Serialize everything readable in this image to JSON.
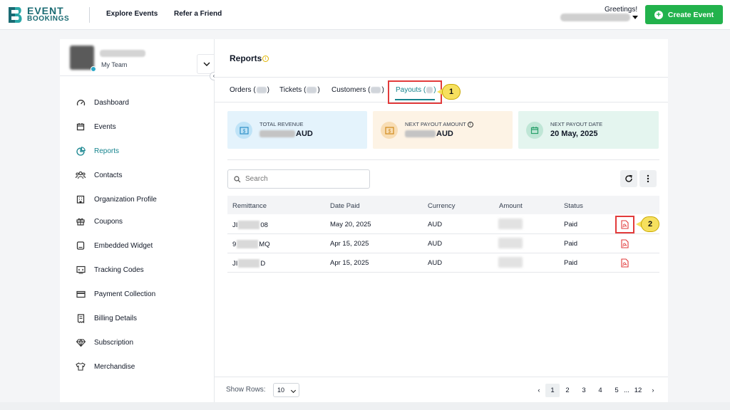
{
  "header": {
    "logo_line1": "EVENT",
    "logo_line2": "BOOKINGS",
    "nav": [
      "Explore Events",
      "Refer a Friend"
    ],
    "greeting": "Greetings!",
    "create_label": "Create Event"
  },
  "sidebar": {
    "team_label": "My Team",
    "items": [
      {
        "label": "Dashboard",
        "icon": "gauge-icon"
      },
      {
        "label": "Events",
        "icon": "calendar-icon"
      },
      {
        "label": "Reports",
        "icon": "pie-chart-icon",
        "active": true
      },
      {
        "label": "Contacts",
        "icon": "users-icon"
      },
      {
        "label": "Organization Profile",
        "icon": "building-icon"
      },
      {
        "label": "Coupons",
        "icon": "gift-icon"
      },
      {
        "label": "Embedded Widget",
        "icon": "widget-icon"
      },
      {
        "label": "Tracking Codes",
        "icon": "code-icon"
      },
      {
        "label": "Payment Collection",
        "icon": "card-icon"
      },
      {
        "label": "Billing Details",
        "icon": "receipt-icon"
      },
      {
        "label": "Subscription",
        "icon": "diamond-icon"
      },
      {
        "label": "Merchandise",
        "icon": "shirt-icon"
      }
    ]
  },
  "main": {
    "title": "Reports",
    "tabs": [
      {
        "label": "Orders"
      },
      {
        "label": "Tickets"
      },
      {
        "label": "Customers"
      },
      {
        "label": "Payouts",
        "active": true
      }
    ],
    "callout_1": "1",
    "callout_2": "2",
    "cards": [
      {
        "label": "TOTAL REVENUE",
        "value": "AUD"
      },
      {
        "label": "NEXT PAYOUT AMOUNT",
        "value": "AUD"
      },
      {
        "label": "NEXT PAYOUT DATE",
        "value": "20 May, 2025"
      }
    ],
    "search_placeholder": "Search",
    "columns": [
      "Remittance",
      "Date Paid",
      "Currency",
      "Amount",
      "Status"
    ],
    "rows": [
      {
        "remit_start": "JI",
        "remit_end": "08",
        "date": "May 20, 2025",
        "currency": "AUD",
        "status": "Paid"
      },
      {
        "remit_start": "9",
        "remit_end": "MQ",
        "date": "Apr 15, 2025",
        "currency": "AUD",
        "status": "Paid"
      },
      {
        "remit_start": "JI",
        "remit_end": "D",
        "date": "Apr 15, 2025",
        "currency": "AUD",
        "status": "Paid"
      }
    ],
    "rows_label": "Show Rows:",
    "rows_value": "10",
    "pages": [
      "1",
      "2",
      "3",
      "4",
      "5",
      "...",
      "12"
    ]
  },
  "colors": {
    "brand": "#1a6b73",
    "accent": "#16848e",
    "create": "#22b24c",
    "highlight": "#e23b3b",
    "callout": "#f6e05e"
  }
}
